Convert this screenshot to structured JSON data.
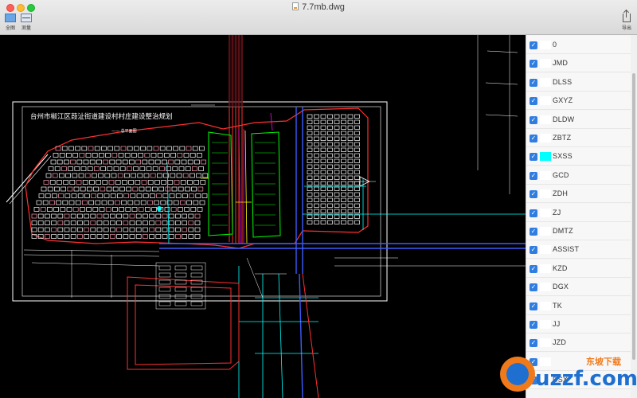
{
  "window": {
    "title": "7.7mb.dwg"
  },
  "toolbar": {
    "full_view_label": "全图",
    "measure_label": "测量",
    "export_label": "导出"
  },
  "drawing": {
    "title": "台州市椒江区葭沚街道建设村村庄建设整治规划",
    "subtitle": "—— 总平面图"
  },
  "layers": [
    {
      "name": "0",
      "checked": true,
      "color": "#ffffff"
    },
    {
      "name": "JMD",
      "checked": true,
      "color": "#ffffff"
    },
    {
      "name": "DLSS",
      "checked": true,
      "color": "#ffffff"
    },
    {
      "name": "GXYZ",
      "checked": true,
      "color": "#ffffff"
    },
    {
      "name": "DLDW",
      "checked": true,
      "color": "#ffffff"
    },
    {
      "name": "ZBTZ",
      "checked": true,
      "color": "#ffffff"
    },
    {
      "name": "SXSS",
      "checked": true,
      "color": "#00ffff"
    },
    {
      "name": "GCD",
      "checked": true,
      "color": "#ffffff"
    },
    {
      "name": "ZDH",
      "checked": true,
      "color": "#ffffff"
    },
    {
      "name": "ZJ",
      "checked": true,
      "color": "#ffffff"
    },
    {
      "name": "DMTZ",
      "checked": true,
      "color": "#ffffff"
    },
    {
      "name": "ASSIST",
      "checked": true,
      "color": "#ffffff"
    },
    {
      "name": "KZD",
      "checked": true,
      "color": "#ffffff"
    },
    {
      "name": "DGX",
      "checked": true,
      "color": "#ffffff"
    },
    {
      "name": "TK",
      "checked": true,
      "color": "#ffffff"
    },
    {
      "name": "JJ",
      "checked": true,
      "color": "#ffffff"
    },
    {
      "name": "JZD",
      "checked": true,
      "color": "#ffffff"
    },
    {
      "name": "",
      "checked": true,
      "color": "#ffffff"
    },
    {
      "name": "DSX",
      "checked": true,
      "color": "#ffffff"
    }
  ],
  "checkbox_glyph": "✓",
  "watermark": {
    "text": "uzzf.com",
    "brand": "东坡下载"
  },
  "colors": {
    "accent": "#2f7de1",
    "canvas_bg": "#000000",
    "cad_red": "#ff3030",
    "cad_green": "#00ff00",
    "cad_cyan": "#00ffff",
    "cad_blue": "#3c5cff",
    "cad_magenta": "#ff00ff",
    "cad_yellow": "#ffff00"
  }
}
